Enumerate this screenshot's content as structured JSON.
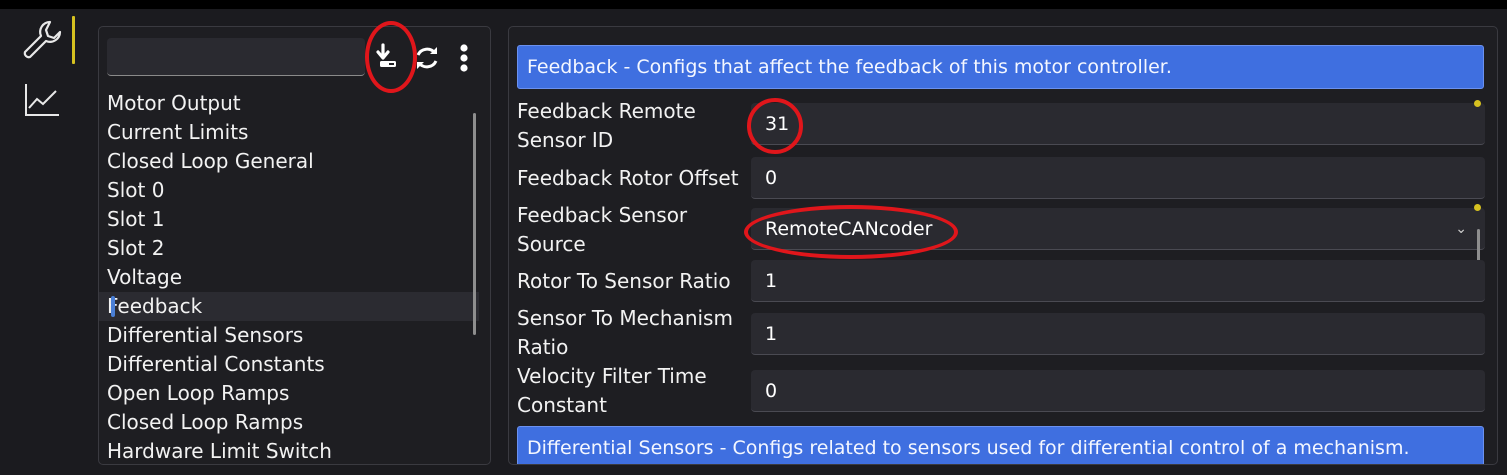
{
  "colors": {
    "accent": "#3f6fe0",
    "rail_indicator": "#d6c120",
    "modified_dot": "#d6c120",
    "annotation": "#e0161b"
  },
  "rail": {
    "items": [
      {
        "name": "wrench-icon",
        "active": true
      },
      {
        "name": "chart-line-icon",
        "active": false
      }
    ]
  },
  "left": {
    "search": {
      "value": "",
      "placeholder": ""
    },
    "toolbar": [
      "download-icon",
      "refresh-icon",
      "more-vertical-icon"
    ],
    "items": [
      "Motor Output",
      "Current Limits",
      "Closed Loop General",
      "Slot 0",
      "Slot 1",
      "Slot 2",
      "Voltage",
      "Feedback",
      "Differential Sensors",
      "Differential Constants",
      "Open Loop Ramps",
      "Closed Loop Ramps",
      "Hardware Limit Switch"
    ],
    "selected_index": 7
  },
  "right": {
    "feedback_header": "Feedback - Configs that affect the feedback of this motor controller.",
    "fields": [
      {
        "label": "Feedback Remote Sensor ID",
        "value": "31",
        "modified": true
      },
      {
        "label": "Feedback Rotor Offset",
        "value": "0",
        "modified": false
      },
      {
        "label": "Feedback Sensor Source",
        "value": "RemoteCANcoder",
        "modified": true,
        "dropdown": true
      },
      {
        "label": "Rotor To Sensor Ratio",
        "value": "1",
        "modified": false
      },
      {
        "label": "Sensor To Mechanism Ratio",
        "value": "1",
        "modified": false
      },
      {
        "label": "Velocity Filter Time Constant",
        "value": "0",
        "modified": false
      }
    ],
    "differential_header": "Differential Sensors - Configs related to sensors used for differential control of a mechanism."
  }
}
